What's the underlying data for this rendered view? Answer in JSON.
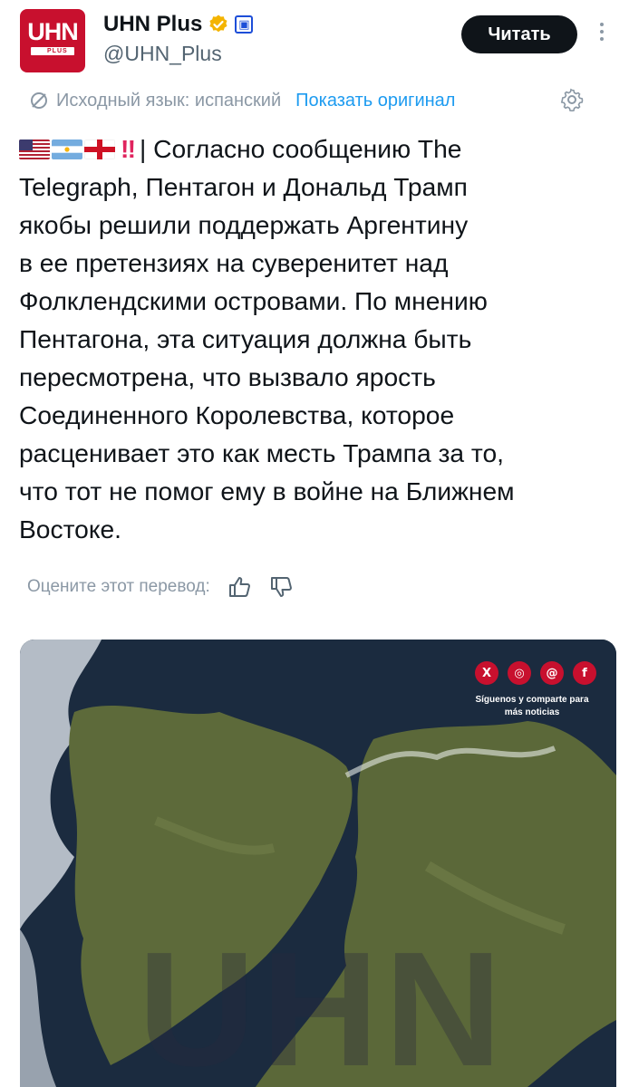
{
  "account": {
    "display_name": "UHN Plus",
    "handle": "@UHN_Plus",
    "avatar_text": "UHN",
    "avatar_subtext": "PLUS",
    "verified_color": "#f4b400",
    "brand_color": "#c8102e"
  },
  "actions": {
    "follow_label": "Читать",
    "more_icon": "more-vertical-icon"
  },
  "translation": {
    "source_label": "Исходный язык: испанский",
    "show_original_label": "Показать оригинал",
    "settings_icon": "gear-icon"
  },
  "tweet": {
    "flags": [
      "us-flag",
      "argentina-flag",
      "england-flag"
    ],
    "lines": [
      "| Согласно сообщению The",
      "Telegraph, Пентагон и Дональд Трамп",
      "якобы решили поддержать Аргентину",
      "в ее претензиях на суверенитет над",
      "Фолклендскими островами. По мнению",
      "Пентагона, эта ситуация должна быть",
      "пересмотрена, что вызвало ярость",
      "Соединенного Королевства, которое",
      "расценивает это как месть Трампа за то,",
      "что тот не помог ему в войне на Ближнем",
      "Востоке."
    ]
  },
  "rating": {
    "label": "Оцените этот перевод:",
    "up_icon": "thumbs-up-icon",
    "down_icon": "thumbs-down-icon"
  },
  "media": {
    "social_icons": [
      "x-icon",
      "instagram-icon",
      "threads-icon",
      "facebook-icon"
    ],
    "social_x": "X",
    "social_instagram": "◎",
    "social_threads": "@",
    "social_facebook": "f",
    "caption_line1": "Síguenos y comparte para",
    "caption_line2": "más noticias",
    "watermark": "UHN",
    "ocean_color": "#1b2b3f",
    "land_color": "#5d6a3a"
  }
}
